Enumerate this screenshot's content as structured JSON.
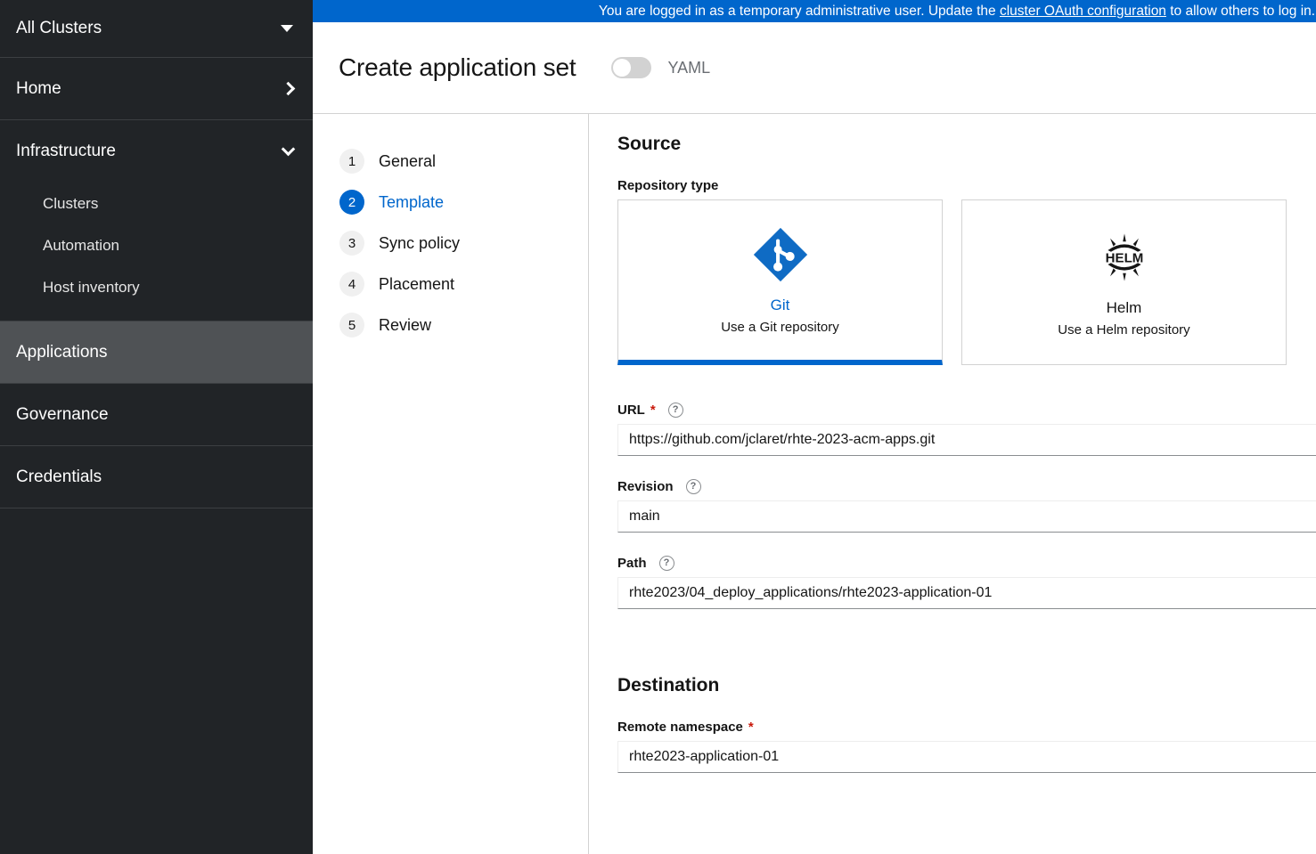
{
  "banner": {
    "text_before": "You are logged in as a temporary administrative user. Update the ",
    "link": "cluster OAuth configuration",
    "text_after": " to allow others to log in."
  },
  "sidebar": {
    "cluster_selector": {
      "label": "All Clusters",
      "icon": "caret-down-icon"
    },
    "items": [
      {
        "label": "Home",
        "icon": "chevron-right-icon",
        "expanded": false
      },
      {
        "label": "Infrastructure",
        "icon": "chevron-down-icon",
        "expanded": true
      }
    ],
    "infrastructure_children": [
      {
        "label": "Clusters"
      },
      {
        "label": "Automation"
      },
      {
        "label": "Host inventory"
      }
    ],
    "bottom_items": [
      {
        "label": "Applications",
        "active": true
      },
      {
        "label": "Governance",
        "active": false
      },
      {
        "label": "Credentials",
        "active": false
      }
    ]
  },
  "header": {
    "title": "Create application set",
    "yaml_label": "YAML",
    "yaml_toggle_state": "off"
  },
  "wizard": {
    "steps": [
      {
        "number": "1",
        "label": "General",
        "active": false
      },
      {
        "number": "2",
        "label": "Template",
        "active": true
      },
      {
        "number": "3",
        "label": "Sync policy",
        "active": false
      },
      {
        "number": "4",
        "label": "Placement",
        "active": false
      },
      {
        "number": "5",
        "label": "Review",
        "active": false
      }
    ]
  },
  "source": {
    "heading": "Source",
    "repository_type_label": "Repository type",
    "cards": [
      {
        "icon": "git-icon",
        "title": "Git",
        "description": "Use a Git repository",
        "selected": true
      },
      {
        "icon": "helm-icon",
        "title": "Helm",
        "description": "Use a Helm repository",
        "selected": false
      }
    ],
    "fields": [
      {
        "label": "URL",
        "required": true,
        "help": "?",
        "value": "https://github.com/jclaret/rhte-2023-acm-apps.git",
        "placeholder": ""
      },
      {
        "label": "Revision",
        "required": false,
        "help": "?",
        "value": "main",
        "placeholder": ""
      },
      {
        "label": "Path",
        "required": false,
        "help": "?",
        "value": "rhte2023/04_deploy_applications/rhte2023-application-01",
        "placeholder": ""
      }
    ]
  },
  "destination": {
    "heading": "Destination",
    "field": {
      "label": "Remote namespace",
      "required": true,
      "value": "rhte2023-application-01",
      "placeholder": ""
    }
  },
  "colors": {
    "accent_blue": "#0066cc",
    "sidebar_bg": "#212427",
    "sidebar_active": "#4f5255",
    "required_red": "#c9190b"
  }
}
